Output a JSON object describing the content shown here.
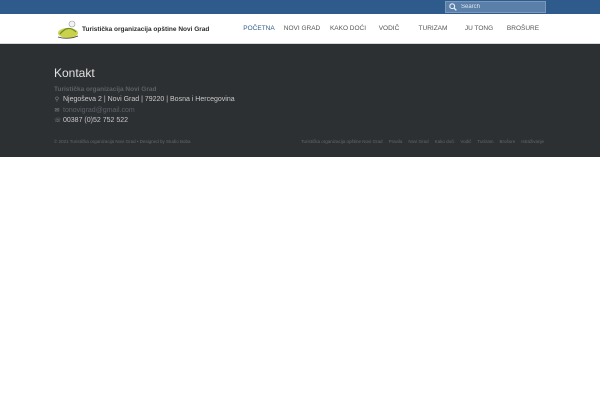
{
  "search": {
    "placeholder": "Search"
  },
  "brand": {
    "name": "Turistička organizacija opštine Novi Grad"
  },
  "nav": [
    {
      "label": "POČETNA"
    },
    {
      "label": "NOVI GRAD"
    },
    {
      "label": "KAKO DOĆI"
    },
    {
      "label": "VODIČ"
    },
    {
      "label": "TURIZAM"
    },
    {
      "label": "JU TONG"
    },
    {
      "label": "BROŠURE"
    }
  ],
  "contact": {
    "title": "Kontakt",
    "org": "Turistička organizacija Novi Grad",
    "address": "Njegoševa 2 | Novi Grad | 79220 | Bosna i Hercegovina",
    "email": "tonovigrad@gmail.com",
    "phone": "00387 (0)52 752 522"
  },
  "footer": {
    "copyright": "© 2021 Turistička organizacija Novi Grad • Designed by Studio Boba",
    "links": [
      {
        "label": "Turistička organizacija opštine Novi Grad"
      },
      {
        "label": "Pravila"
      },
      {
        "label": "Novi Grad"
      },
      {
        "label": "Kako doći"
      },
      {
        "label": "Vodič"
      },
      {
        "label": "Turizam"
      },
      {
        "label": "Brošure"
      },
      {
        "label": "Istraživanje"
      }
    ]
  },
  "colors": {
    "topbar": "#2f5b8c",
    "footer": "#2d3033",
    "active_nav": "#2f5b8c"
  }
}
